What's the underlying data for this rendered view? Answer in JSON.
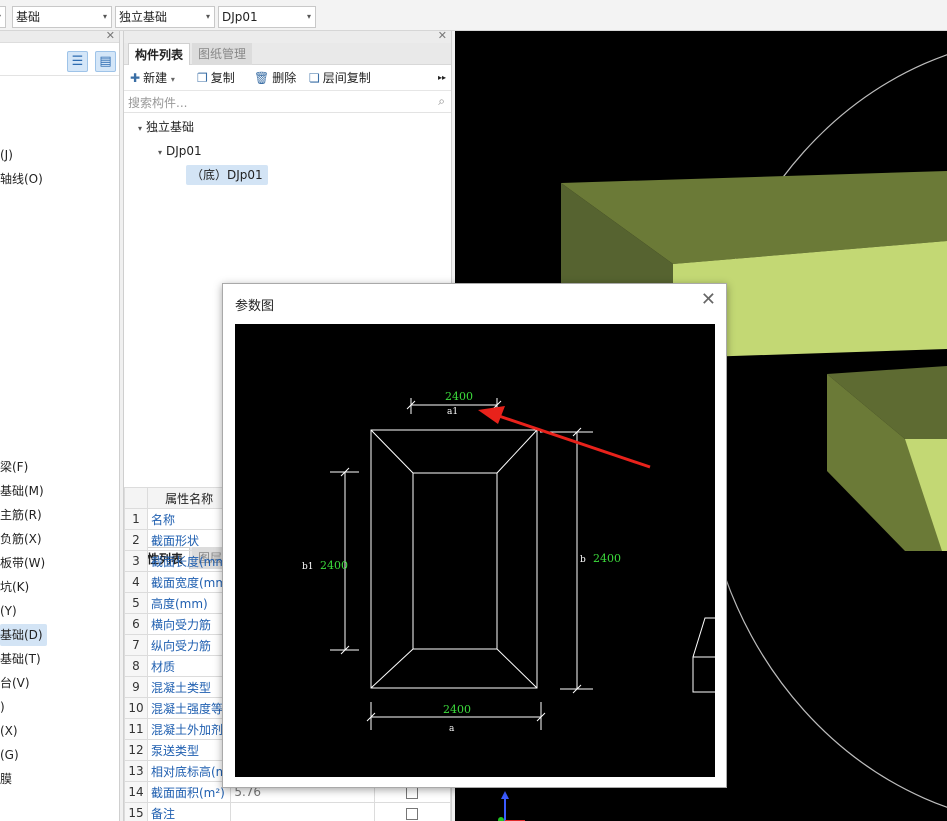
{
  "selectors": {
    "floor_value": "基础",
    "category_value": "独立基础",
    "component_value": "DJp01"
  },
  "left_panel": {
    "items": [
      {
        "label": "(J)"
      },
      {
        "label": "轴线(O)"
      },
      {
        "label": "梁(F)"
      },
      {
        "label": "基础(M)"
      },
      {
        "label": "主筋(R)"
      },
      {
        "label": "负筋(X)"
      },
      {
        "label": "板带(W)"
      },
      {
        "label": "坑(K)"
      },
      {
        "label": "(Y)"
      },
      {
        "label": "基础(D)"
      },
      {
        "label": "基础(T)"
      },
      {
        "label": "台(V)"
      },
      {
        "label": ")"
      },
      {
        "label": "(X)"
      },
      {
        "label": "(G)"
      },
      {
        "label": "膜"
      }
    ]
  },
  "component_panel": {
    "tabs": [
      "构件列表",
      "图纸管理"
    ],
    "toolbar": {
      "new_label": "新建",
      "copy_label": "复制",
      "delete_label": "删除",
      "floor_copy_label": "层间复制",
      "more_label": "▸▸"
    },
    "search_placeholder": "搜索构件...",
    "tree": {
      "root": "独立基础",
      "child": "DJp01",
      "leaf": "（底）DJp01"
    }
  },
  "property_panel": {
    "tabs": [
      "属性列表",
      "图层"
    ],
    "header_name": "属性名称",
    "rows": [
      {
        "num": "1",
        "name": "名称",
        "value": ""
      },
      {
        "num": "2",
        "name": "截面形状",
        "value": ""
      },
      {
        "num": "3",
        "name": "截面长度(mm",
        "value": ""
      },
      {
        "num": "4",
        "name": "截面宽度(mm",
        "value": ""
      },
      {
        "num": "5",
        "name": "高度(mm)",
        "value": ""
      },
      {
        "num": "6",
        "name": "横向受力筋",
        "value": ""
      },
      {
        "num": "7",
        "name": "纵向受力筋",
        "value": ""
      },
      {
        "num": "8",
        "name": "材质",
        "value": ""
      },
      {
        "num": "9",
        "name": "混凝土类型",
        "value": ""
      },
      {
        "num": "10",
        "name": "混凝土强度等",
        "value": ""
      },
      {
        "num": "11",
        "name": "混凝土外加剂",
        "value": ""
      },
      {
        "num": "12",
        "name": "泵送类型",
        "value": ""
      },
      {
        "num": "13",
        "name": "相对底标高(m",
        "value": ""
      },
      {
        "num": "14",
        "name": "截面面积(m²)",
        "value": "5.76",
        "checkbox": true
      },
      {
        "num": "15",
        "name": "备注",
        "value": "",
        "checkbox": true
      }
    ]
  },
  "dialog": {
    "title": "参数图",
    "close_label": "✕",
    "drawing": {
      "top_dim": "2400",
      "top_param": "a1",
      "left_dim": "2400",
      "left_param": "b1",
      "right_dim": "2400",
      "right_param": "b",
      "bottom_dim": "2400",
      "bottom_param": "a"
    }
  },
  "colors": {
    "viewport_bg": "#000000",
    "slab_top": "#c3d874",
    "slab_side": "#6b7a37",
    "dim_text": "#3cdc3c",
    "arrow": "#e8221b",
    "selection": "#d3e4f5"
  }
}
